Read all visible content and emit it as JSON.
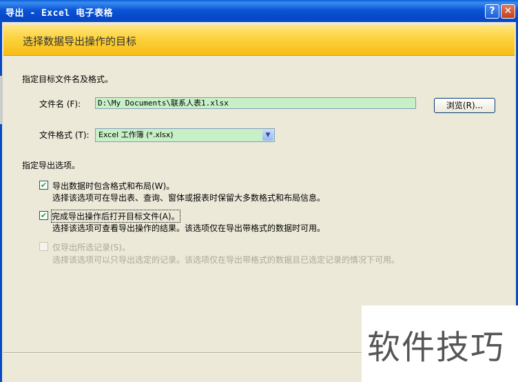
{
  "window": {
    "title": "导出 - Excel 电子表格",
    "help_label": "?",
    "close_label": "✕"
  },
  "banner": {
    "title": "选择数据导出操作的目标"
  },
  "file_section": {
    "heading": "指定目标文件名及格式。",
    "filename_label": "文件名 (F):",
    "filename_value": "D:\\My Documents\\联系人表1.xlsx",
    "browse_label": "浏览(R)...",
    "format_label": "文件格式 (T):",
    "format_value": "Excel 工作簿 (*.xlsx)"
  },
  "export_options": {
    "heading": "指定导出选项。",
    "options": [
      {
        "title": "导出数据时包含格式和布局(W)。",
        "description": "选择该选项可在导出表、查询、窗体或报表时保留大多数格式和布局信息。",
        "checked": true,
        "enabled": true
      },
      {
        "title": "完成导出操作后打开目标文件(A)。",
        "description": "选择该选项可查看导出操作的结果。该选项仅在导出带格式的数据时可用。",
        "checked": true,
        "enabled": true
      },
      {
        "title": "仅导出所选记录(S)。",
        "description": "选择该选项可以只导出选定的记录。该选项仅在导出带格式的数据且已选定记录的情况下可用。",
        "checked": false,
        "enabled": false
      }
    ]
  },
  "watermark": {
    "text": "软件技巧"
  }
}
